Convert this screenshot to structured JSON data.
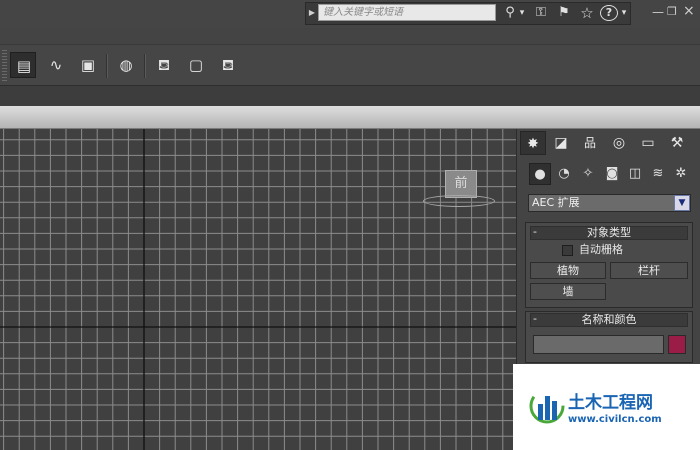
{
  "search": {
    "placeholder": "键入关键字或短语"
  },
  "top_icons": [
    {
      "name": "binoculars-icon",
      "glyph": "⚲"
    },
    {
      "name": "dropdown-arrow-icon",
      "glyph": "▾"
    },
    {
      "name": "key-icon",
      "glyph": "⚿"
    },
    {
      "name": "satellite-icon",
      "glyph": "⚑"
    },
    {
      "name": "star-icon",
      "glyph": "☆"
    },
    {
      "name": "help-icon",
      "glyph": "?"
    },
    {
      "name": "help-dropdown-icon",
      "glyph": "▾"
    }
  ],
  "window_controls": {
    "minimize": "—",
    "restore": "❐",
    "close": "×"
  },
  "toolbar": {
    "buttons": [
      {
        "name": "layer-manager-icon",
        "glyph": "▤"
      },
      {
        "name": "curve-editor-icon",
        "glyph": "∿"
      },
      {
        "name": "schematic-view-icon",
        "glyph": "▣"
      },
      {
        "name": "material-editor-icon",
        "glyph": "◍"
      },
      {
        "name": "render-setup-icon",
        "glyph": "⛾"
      },
      {
        "name": "rendered-frame-window-icon",
        "glyph": "▢"
      },
      {
        "name": "render-production-icon",
        "glyph": "⛾"
      }
    ]
  },
  "viewport": {
    "viewcube_label": "前"
  },
  "command_panel": {
    "tabs": [
      {
        "name": "create-tab-icon",
        "glyph": "✸"
      },
      {
        "name": "modify-tab-icon",
        "glyph": "◪"
      },
      {
        "name": "hierarchy-tab-icon",
        "glyph": "品"
      },
      {
        "name": "motion-tab-icon",
        "glyph": "◎"
      },
      {
        "name": "display-tab-icon",
        "glyph": "▭"
      },
      {
        "name": "utilities-tab-icon",
        "glyph": "⚒"
      }
    ],
    "subcategories": [
      {
        "name": "geometry-icon",
        "glyph": "●"
      },
      {
        "name": "shapes-icon",
        "glyph": "◔"
      },
      {
        "name": "lights-icon",
        "glyph": "✧"
      },
      {
        "name": "cameras-icon",
        "glyph": "◙"
      },
      {
        "name": "helpers-icon",
        "glyph": "◫"
      },
      {
        "name": "space-warps-icon",
        "glyph": "≋"
      },
      {
        "name": "systems-icon",
        "glyph": "✲"
      }
    ],
    "category_dropdown": {
      "selected": "AEC 扩展"
    },
    "object_type": {
      "header": "对象类型",
      "collapse": "-",
      "autogrid_label": "自动栅格",
      "autogrid_checked": false,
      "buttons": {
        "foliage": "植物",
        "railing": "栏杆",
        "wall": "墙"
      }
    },
    "name_color": {
      "header": "名称和颜色",
      "collapse": "-",
      "name_value": "",
      "swatch_color": "#9a1d47"
    }
  },
  "watermark": {
    "title": "土木工程网",
    "url": "www.civilcn.com"
  }
}
